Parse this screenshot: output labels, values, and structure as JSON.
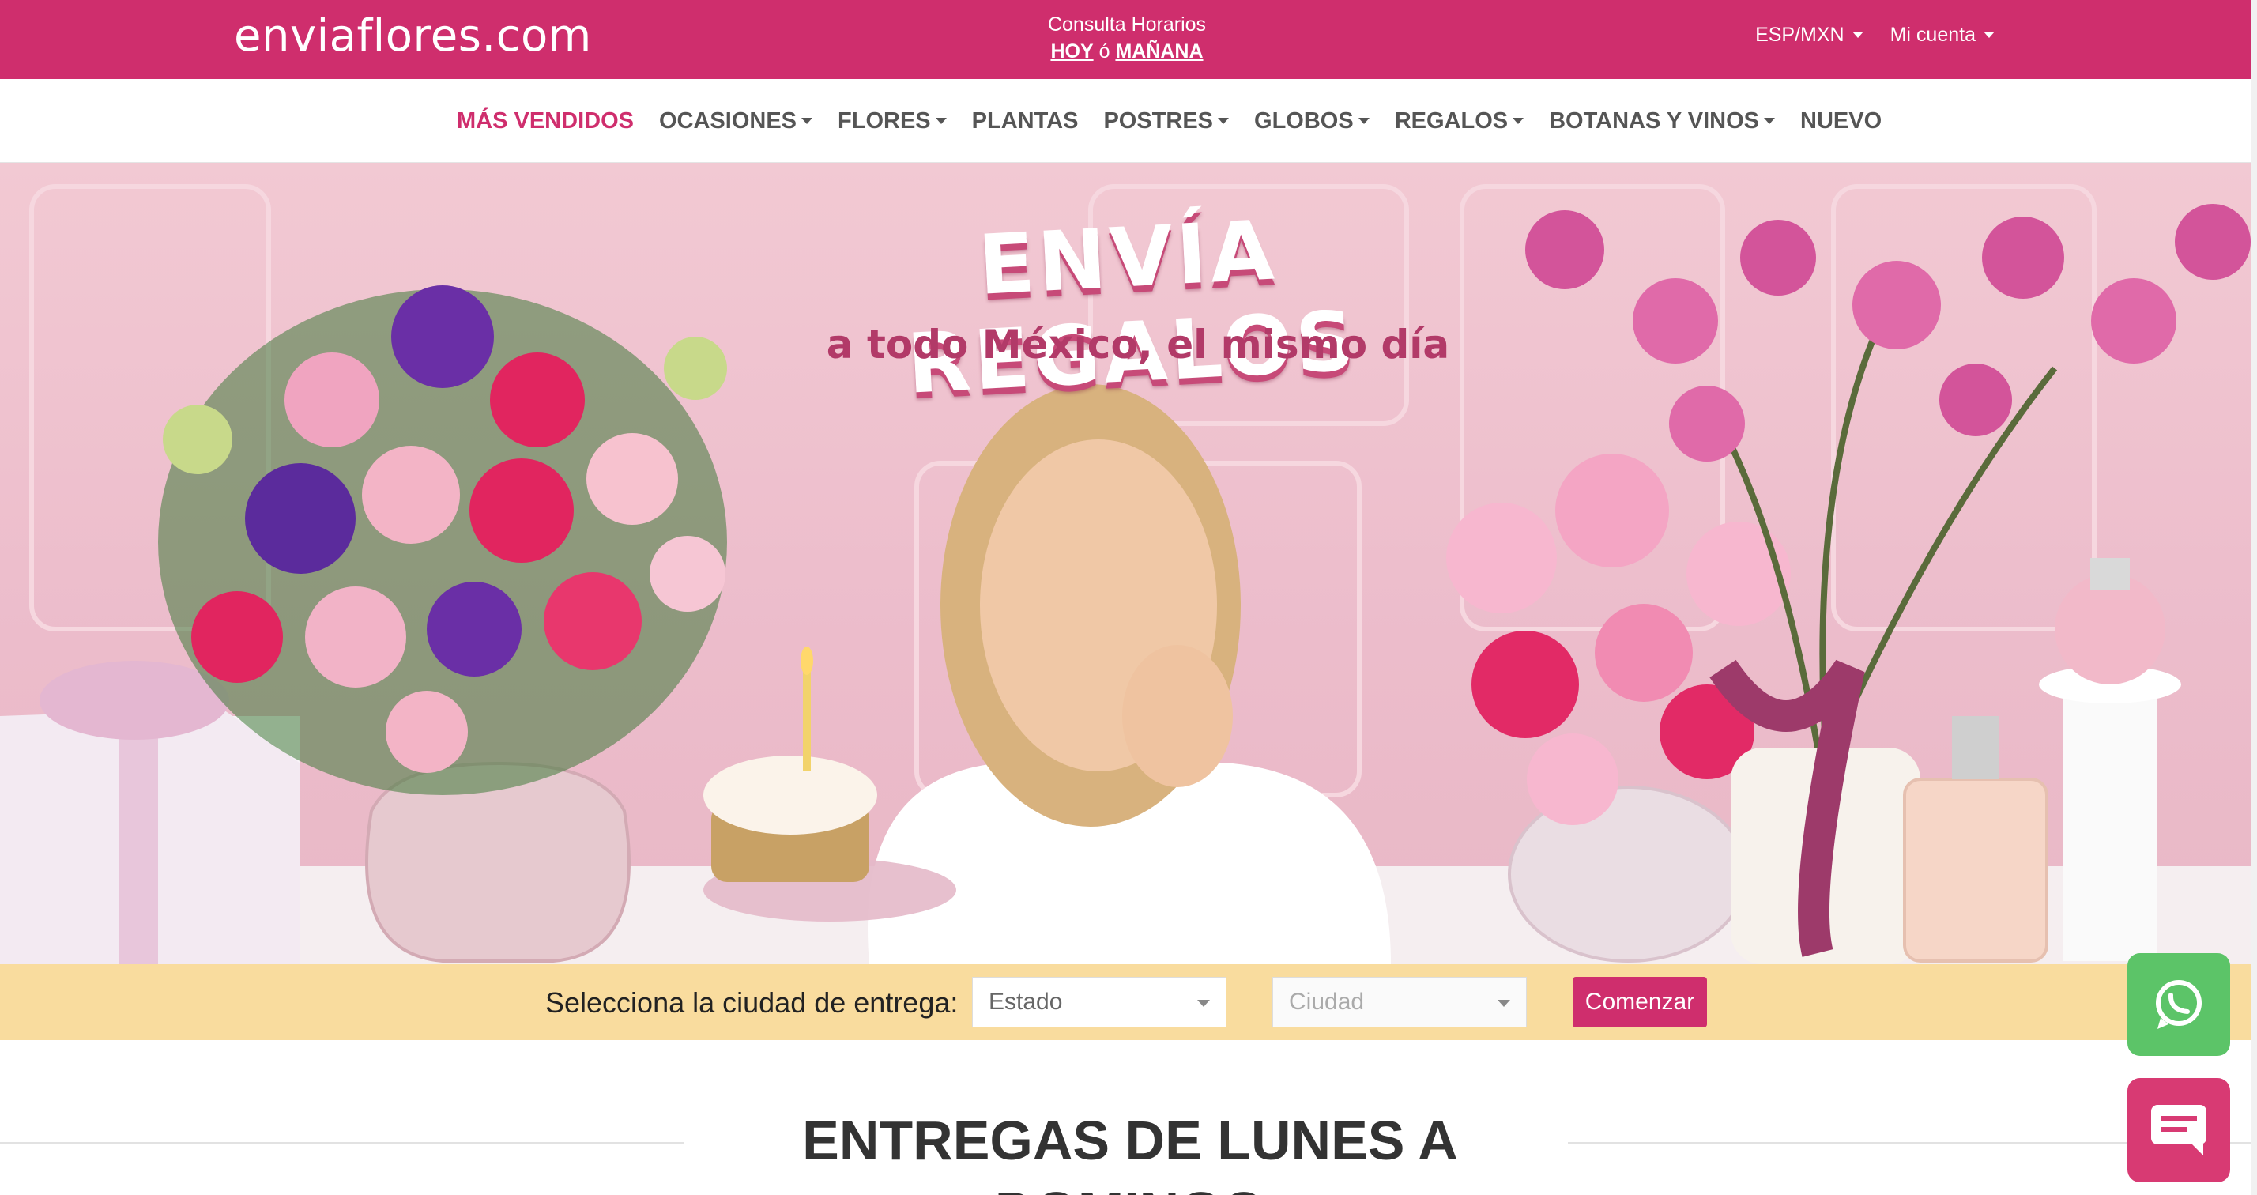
{
  "topbar": {
    "logo": "enviaflores.com",
    "schedule_title": "Consulta Horarios",
    "schedule_today": "HOY",
    "schedule_or": "ó",
    "schedule_tomorrow": "MAÑANA",
    "language_currency": "ESP/MXN",
    "account": "Mi cuenta"
  },
  "nav": {
    "items": [
      {
        "label": "MÁS VENDIDOS",
        "dropdown": false,
        "active": true
      },
      {
        "label": "OCASIONES",
        "dropdown": true
      },
      {
        "label": "FLORES",
        "dropdown": true
      },
      {
        "label": "PLANTAS",
        "dropdown": false
      },
      {
        "label": "POSTRES",
        "dropdown": true
      },
      {
        "label": "GLOBOS",
        "dropdown": true
      },
      {
        "label": "REGALOS",
        "dropdown": true
      },
      {
        "label": "BOTANAS Y VINOS",
        "dropdown": true
      },
      {
        "label": "NUEVO",
        "dropdown": false
      }
    ]
  },
  "hero": {
    "headline": "ENVÍA REGALOS",
    "subheadline": "a todo México, el mismo día"
  },
  "selector": {
    "label": "Selecciona la ciudad de entrega:",
    "state_value": "Estado",
    "city_value": "Ciudad",
    "button": "Comenzar"
  },
  "section": {
    "heading": "ENTREGAS DE LUNES A DOMINGO"
  },
  "floating": {
    "whatsapp_icon": "whatsapp-icon",
    "chat_icon": "chat-icon"
  },
  "colors": {
    "brand_pink": "#cf2e6d",
    "selector_bg": "#f9dc9e",
    "whatsapp_green": "#5cc468"
  }
}
